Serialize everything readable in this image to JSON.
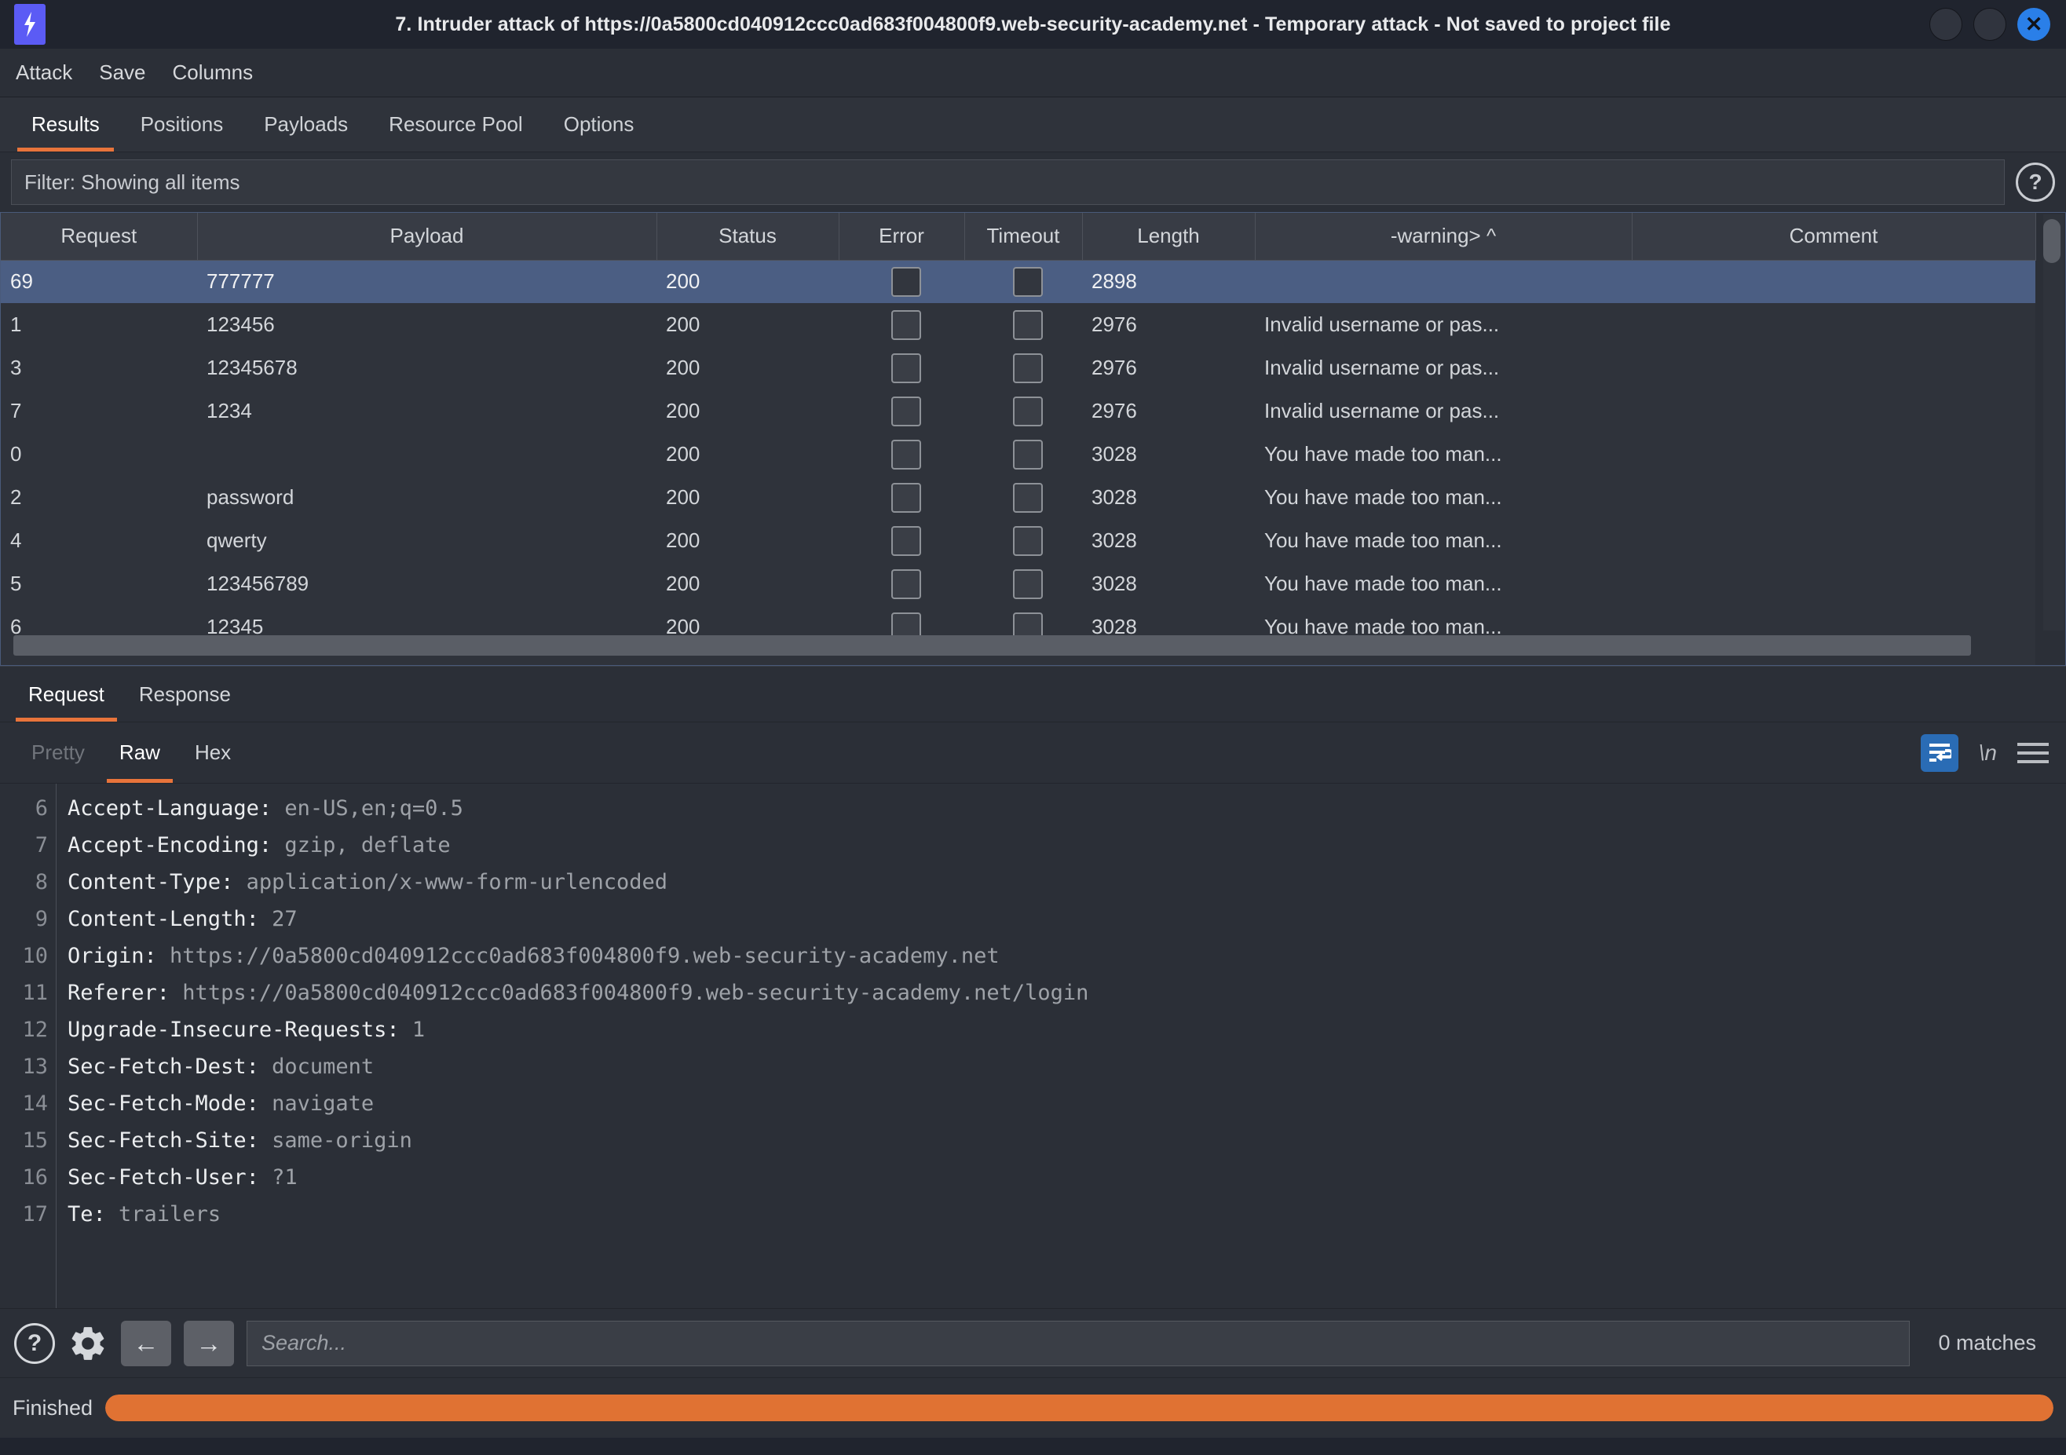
{
  "window": {
    "title": "7. Intruder attack of https://0a5800cd040912ccc0ad683f004800f9.web-security-academy.net - Temporary attack - Not saved to project file",
    "app_icon": "burp-lightning-icon",
    "minimize_label": "",
    "maximize_label": "",
    "close_label": "✕"
  },
  "menubar": {
    "items": [
      {
        "label": "Attack"
      },
      {
        "label": "Save"
      },
      {
        "label": "Columns"
      }
    ]
  },
  "tabs": [
    {
      "label": "Results",
      "active": true
    },
    {
      "label": "Positions",
      "active": false
    },
    {
      "label": "Payloads",
      "active": false
    },
    {
      "label": "Resource Pool",
      "active": false
    },
    {
      "label": "Options",
      "active": false
    }
  ],
  "filter": {
    "text": "Filter: Showing all items",
    "help_label": "?"
  },
  "results_table": {
    "columns": [
      "Request",
      "Payload",
      "Status",
      "Error",
      "Timeout",
      "Length",
      "-warning> ^",
      "Comment"
    ],
    "sort_column": "-warning>",
    "sort_direction": "ascending",
    "rows": [
      {
        "request": "69",
        "payload": "777777",
        "status": "200",
        "error": false,
        "timeout": false,
        "length": "2898",
        "warning": "",
        "comment": "",
        "selected": true
      },
      {
        "request": "1",
        "payload": "123456",
        "status": "200",
        "error": false,
        "timeout": false,
        "length": "2976",
        "warning": "Invalid username or pas...",
        "comment": "",
        "selected": false
      },
      {
        "request": "3",
        "payload": "12345678",
        "status": "200",
        "error": false,
        "timeout": false,
        "length": "2976",
        "warning": "Invalid username or pas...",
        "comment": "",
        "selected": false
      },
      {
        "request": "7",
        "payload": "1234",
        "status": "200",
        "error": false,
        "timeout": false,
        "length": "2976",
        "warning": "Invalid username or pas...",
        "comment": "",
        "selected": false
      },
      {
        "request": "0",
        "payload": "",
        "status": "200",
        "error": false,
        "timeout": false,
        "length": "3028",
        "warning": "You have made too man...",
        "comment": "",
        "selected": false
      },
      {
        "request": "2",
        "payload": "password",
        "status": "200",
        "error": false,
        "timeout": false,
        "length": "3028",
        "warning": "You have made too man...",
        "comment": "",
        "selected": false
      },
      {
        "request": "4",
        "payload": "qwerty",
        "status": "200",
        "error": false,
        "timeout": false,
        "length": "3028",
        "warning": "You have made too man...",
        "comment": "",
        "selected": false
      },
      {
        "request": "5",
        "payload": "123456789",
        "status": "200",
        "error": false,
        "timeout": false,
        "length": "3028",
        "warning": "You have made too man...",
        "comment": "",
        "selected": false
      },
      {
        "request": "6",
        "payload": "12345",
        "status": "200",
        "error": false,
        "timeout": false,
        "length": "3028",
        "warning": "You have made too man...",
        "comment": "",
        "selected": false
      }
    ]
  },
  "message_tabs": [
    {
      "label": "Request",
      "active": true
    },
    {
      "label": "Response",
      "active": false
    }
  ],
  "editor_tabs": [
    {
      "label": "Pretty",
      "active": false,
      "dim": true
    },
    {
      "label": "Raw",
      "active": true,
      "dim": false
    },
    {
      "label": "Hex",
      "active": false,
      "dim": false
    }
  ],
  "editor_tools": {
    "wrap_icon": "word-wrap-icon",
    "newline_icon": "\\n",
    "menu_icon": "hamburger-menu-icon"
  },
  "request_lines": [
    {
      "num": "6",
      "key": "Accept-Language:",
      "value": " en-US,en;q=0.5"
    },
    {
      "num": "7",
      "key": "Accept-Encoding:",
      "value": " gzip, deflate"
    },
    {
      "num": "8",
      "key": "Content-Type:",
      "value": " application/x-www-form-urlencoded"
    },
    {
      "num": "9",
      "key": "Content-Length:",
      "value": " 27"
    },
    {
      "num": "10",
      "key": "Origin:",
      "value": " https://0a5800cd040912ccc0ad683f004800f9.web-security-academy.net"
    },
    {
      "num": "11",
      "key": "Referer:",
      "value": " https://0a5800cd040912ccc0ad683f004800f9.web-security-academy.net/login"
    },
    {
      "num": "12",
      "key": "Upgrade-Insecure-Requests:",
      "value": " 1"
    },
    {
      "num": "13",
      "key": "Sec-Fetch-Dest:",
      "value": " document"
    },
    {
      "num": "14",
      "key": "Sec-Fetch-Mode:",
      "value": " navigate"
    },
    {
      "num": "15",
      "key": "Sec-Fetch-Site:",
      "value": " same-origin"
    },
    {
      "num": "16",
      "key": "Sec-Fetch-User:",
      "value": " ?1"
    },
    {
      "num": "17",
      "key": "Te:",
      "value": " trailers"
    }
  ],
  "search": {
    "help_label": "?",
    "settings_icon": "gear-icon",
    "prev_label": "←",
    "next_label": "→",
    "placeholder": "Search...",
    "value": "",
    "matches": "0 matches"
  },
  "status": {
    "label": "Finished",
    "progress_percent": 100
  },
  "colors": {
    "accent_orange": "#e8743b",
    "selection_blue": "#4b5e83",
    "close_blue": "#2a7fe8",
    "wrap_active_blue": "#2a6cb5"
  }
}
